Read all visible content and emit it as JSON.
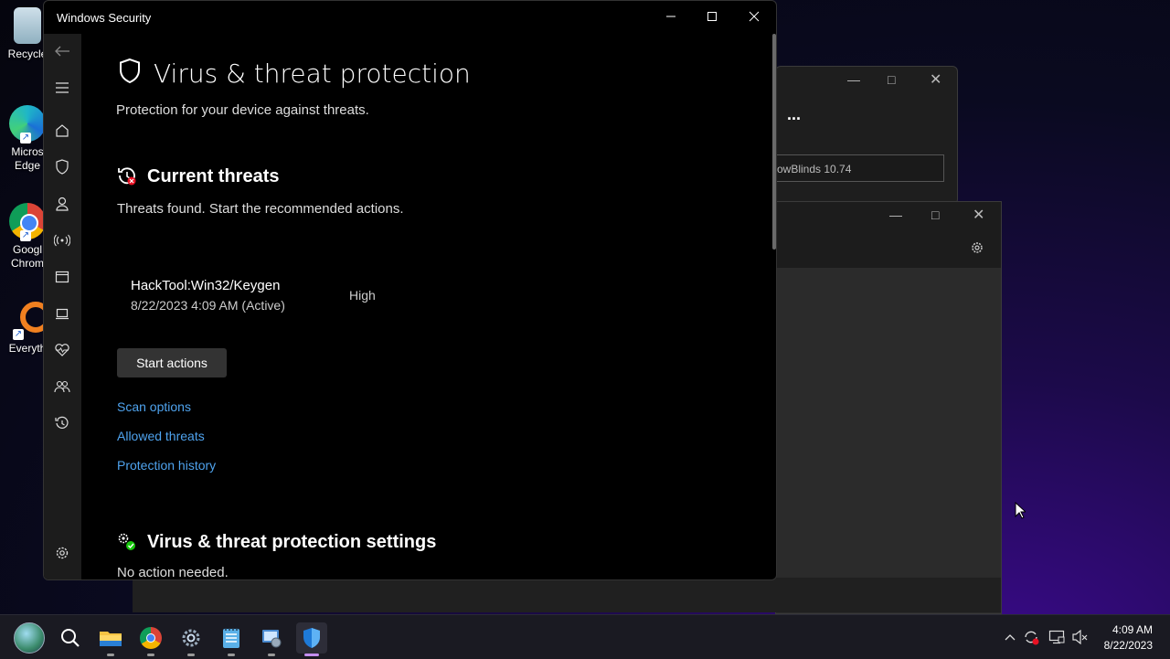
{
  "desktop": {
    "icons": [
      {
        "label": "Recycle",
        "color": "#9ab"
      },
      {
        "label": "Micros\nEdge",
        "line1": "Micros",
        "line2": "Edge"
      },
      {
        "line1": "Googl",
        "line2": "Chrom"
      },
      {
        "line1": "Everyth"
      }
    ]
  },
  "bg_window_1": {
    "more_label": "...",
    "input_value": "owBlinds 10.74"
  },
  "window": {
    "title": "Windows Security",
    "page_title": "Virus & threat protection",
    "page_subtitle": "Protection for your device against threats.",
    "current_threats": {
      "heading": "Current threats",
      "description": "Threats found. Start the recommended actions.",
      "threat_name": "HackTool:Win32/Keygen",
      "threat_time": "8/22/2023 4:09 AM (Active)",
      "threat_severity": "High",
      "start_button": "Start actions",
      "links": [
        "Scan options",
        "Allowed threats",
        "Protection history"
      ]
    },
    "settings_section": {
      "heading": "Virus & threat protection settings",
      "description": "No action needed."
    }
  },
  "taskbar": {
    "time": "4:09 AM",
    "date": "8/22/2023"
  },
  "colors": {
    "link": "#4fa3ee",
    "accent": "#0078d4"
  }
}
